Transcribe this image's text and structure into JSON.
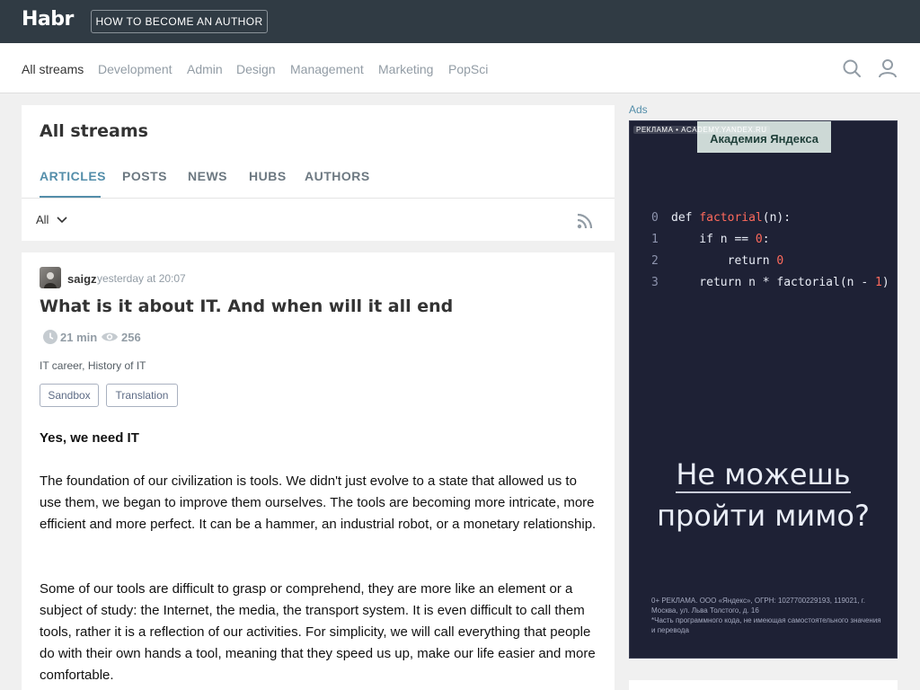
{
  "header": {
    "logo": "Habr",
    "become_author": "HOW TO BECOME AN AUTHOR"
  },
  "nav": {
    "items": [
      "All streams",
      "Development",
      "Admin",
      "Design",
      "Management",
      "Marketing",
      "PopSci"
    ],
    "active": "All streams",
    "icons": [
      "search-icon",
      "user-icon"
    ]
  },
  "feed": {
    "title": "All streams",
    "tabs": [
      "ARTICLES",
      "POSTS",
      "NEWS",
      "HUBS",
      "AUTHORS"
    ],
    "active_tab": "ARTICLES",
    "filter": "All"
  },
  "article": {
    "author": "saigz",
    "date": "yesterday at 20:07",
    "title": "What is it about IT. And when will it all end",
    "reading_time": "21 min",
    "views": "256",
    "hubs": [
      "IT career",
      "History of IT"
    ],
    "labels": [
      "Sandbox",
      "Translation"
    ],
    "subheading": "Yes, we need IT",
    "paragraphs": [
      "The foundation of our civilization is tools. We didn't just evolve to a state that allowed us to use them, we began to improve them ourselves. The tools are becoming more intricate, more efficient and more perfect. It can be a hammer, an industrial robot, or a monetary relationship.",
      "Some of our tools are difficult to grasp or comprehend, they are more like an element or a subject of study: the Internet, the media, the transport system. It is even difficult to call them tools, rather it is a reflection of our activities. For simplicity, we will call everything that people do with their own hands a tool, meaning that they speed us up, make our life easier and more comfortable."
    ]
  },
  "ads": {
    "label": "Ads",
    "tagline": "РЕКЛАМА • ACADEMY.YANDEX.RU",
    "brand": "Академия Яндекса",
    "code": {
      "line_numbers": [
        "0",
        "1",
        "2",
        "3"
      ],
      "l0_def": "def ",
      "l0_fn": "factorial",
      "l0_rest": "(n):",
      "l1_a": "    if n == ",
      "l1_num": "0",
      "l1_b": ":",
      "l2_a": "        return ",
      "l2_num": "0",
      "l3_a": "    return n * factorial(n - ",
      "l3_num": "1",
      "l3_b": ")"
    },
    "headline_1": "Не можешь",
    "headline_2": "пройти мимо?",
    "legal_1": "0+ РЕКЛАМА. ООО «Яндекс», ОГРН: 1027700229193, 119021, г. Москва, ул. Льва Толстого, д. 16",
    "legal_2": "*Часть программного кода, не имеющая самостоятельного значения и перевода"
  }
}
